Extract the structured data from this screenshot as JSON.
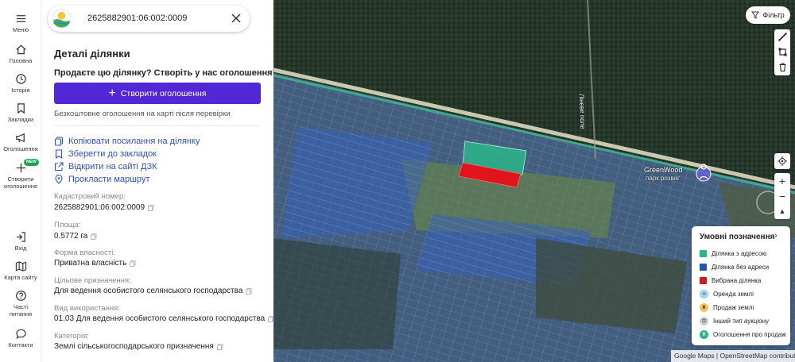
{
  "rail": {
    "menu": "Меню",
    "home": "Головна",
    "history": "Історія",
    "bookmarks": "Закладки",
    "ads": "Оголошення",
    "create_line1": "Створити",
    "create_line2": "оголошення",
    "new_badge": "NEW",
    "login": "Вхід",
    "site_map": "Карта сайту",
    "faq_line1": "Часті",
    "faq_line2": "питання",
    "contacts": "Контакти"
  },
  "search": {
    "value": "2625882901:06:002:0009"
  },
  "details": {
    "title": "Деталі ділянки",
    "promo": "Продаєте цю ділянку? Створіть у нас оголошення!",
    "create_button": "Створити оголошення",
    "free_note": "Безкоштовне оголошення на карті після перевірки",
    "actions": [
      {
        "icon": "copy-icon",
        "label": "Копіювати посилання на ділянку"
      },
      {
        "icon": "bookmark-icon",
        "label": "Зберегти до закладок"
      },
      {
        "icon": "external-link-icon",
        "label": "Відкрити на сайті ДЗК"
      },
      {
        "icon": "location-pin-icon",
        "label": "Прокласти маршрут"
      }
    ],
    "fields": [
      {
        "label": "Кадастровий номер:",
        "value": "2625882901:06:002:0009"
      },
      {
        "label": "Площа:",
        "value": "0.5772 га"
      },
      {
        "label": "Форма власності:",
        "value": "Приватна власність"
      },
      {
        "label": "Цільове призначення:",
        "value": "Для ведення особистого селянського господарства"
      },
      {
        "label": "Вид використання:",
        "value": "01.03 Для ведення особистого селянського господарства"
      },
      {
        "label": "Категорія:",
        "value": "Землі сільськогосподарського призначення"
      }
    ]
  },
  "map": {
    "filter_label": "Фільтр",
    "road_label": "Ліневе поле",
    "poi_label": "GreenWood",
    "poi_label2": "парк розваг",
    "attribution": "Google Maps | OpenStreetMap contributors",
    "legend": {
      "title": "Умовні позначення",
      "items": [
        {
          "kind": "swatch",
          "color": "#2bb58a",
          "label": "Ділянка з адресою"
        },
        {
          "kind": "swatch",
          "color": "#1f56b8",
          "label": "Ділянка без адреси"
        },
        {
          "kind": "swatch",
          "color": "#d11a1a",
          "label": "Вибрана ділянка"
        },
        {
          "kind": "dot",
          "color": "#9fd1f0",
          "glyph": "≈",
          "label": "Оренда землі"
        },
        {
          "kind": "dot",
          "color": "#f5c35a",
          "glyph": "₴",
          "label": "Продаж землі"
        },
        {
          "kind": "dot",
          "color": "#cccccc",
          "glyph": "⚖",
          "label": "Інший тип аукціону"
        },
        {
          "kind": "dot",
          "color": "#2bb58a",
          "glyph": "₴",
          "label": "Оголошення про продаж"
        }
      ]
    }
  }
}
